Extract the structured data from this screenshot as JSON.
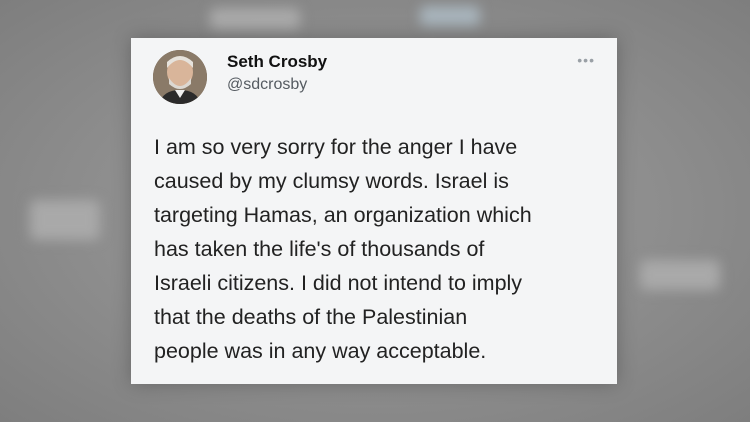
{
  "tweet": {
    "author_name": "Seth Crosby",
    "author_handle": "@sdcrosby",
    "more_icon": "more-horizontal-icon",
    "text_lines": [
      "I am so very sorry for the anger I have",
      "caused by my clumsy words. Israel is",
      "targeting Hamas, an organization which",
      "has taken the life's of thousands of",
      "Israeli citizens. I did not intend to imply",
      "that the deaths of the Palestinian",
      "people was in any way acceptable."
    ]
  }
}
